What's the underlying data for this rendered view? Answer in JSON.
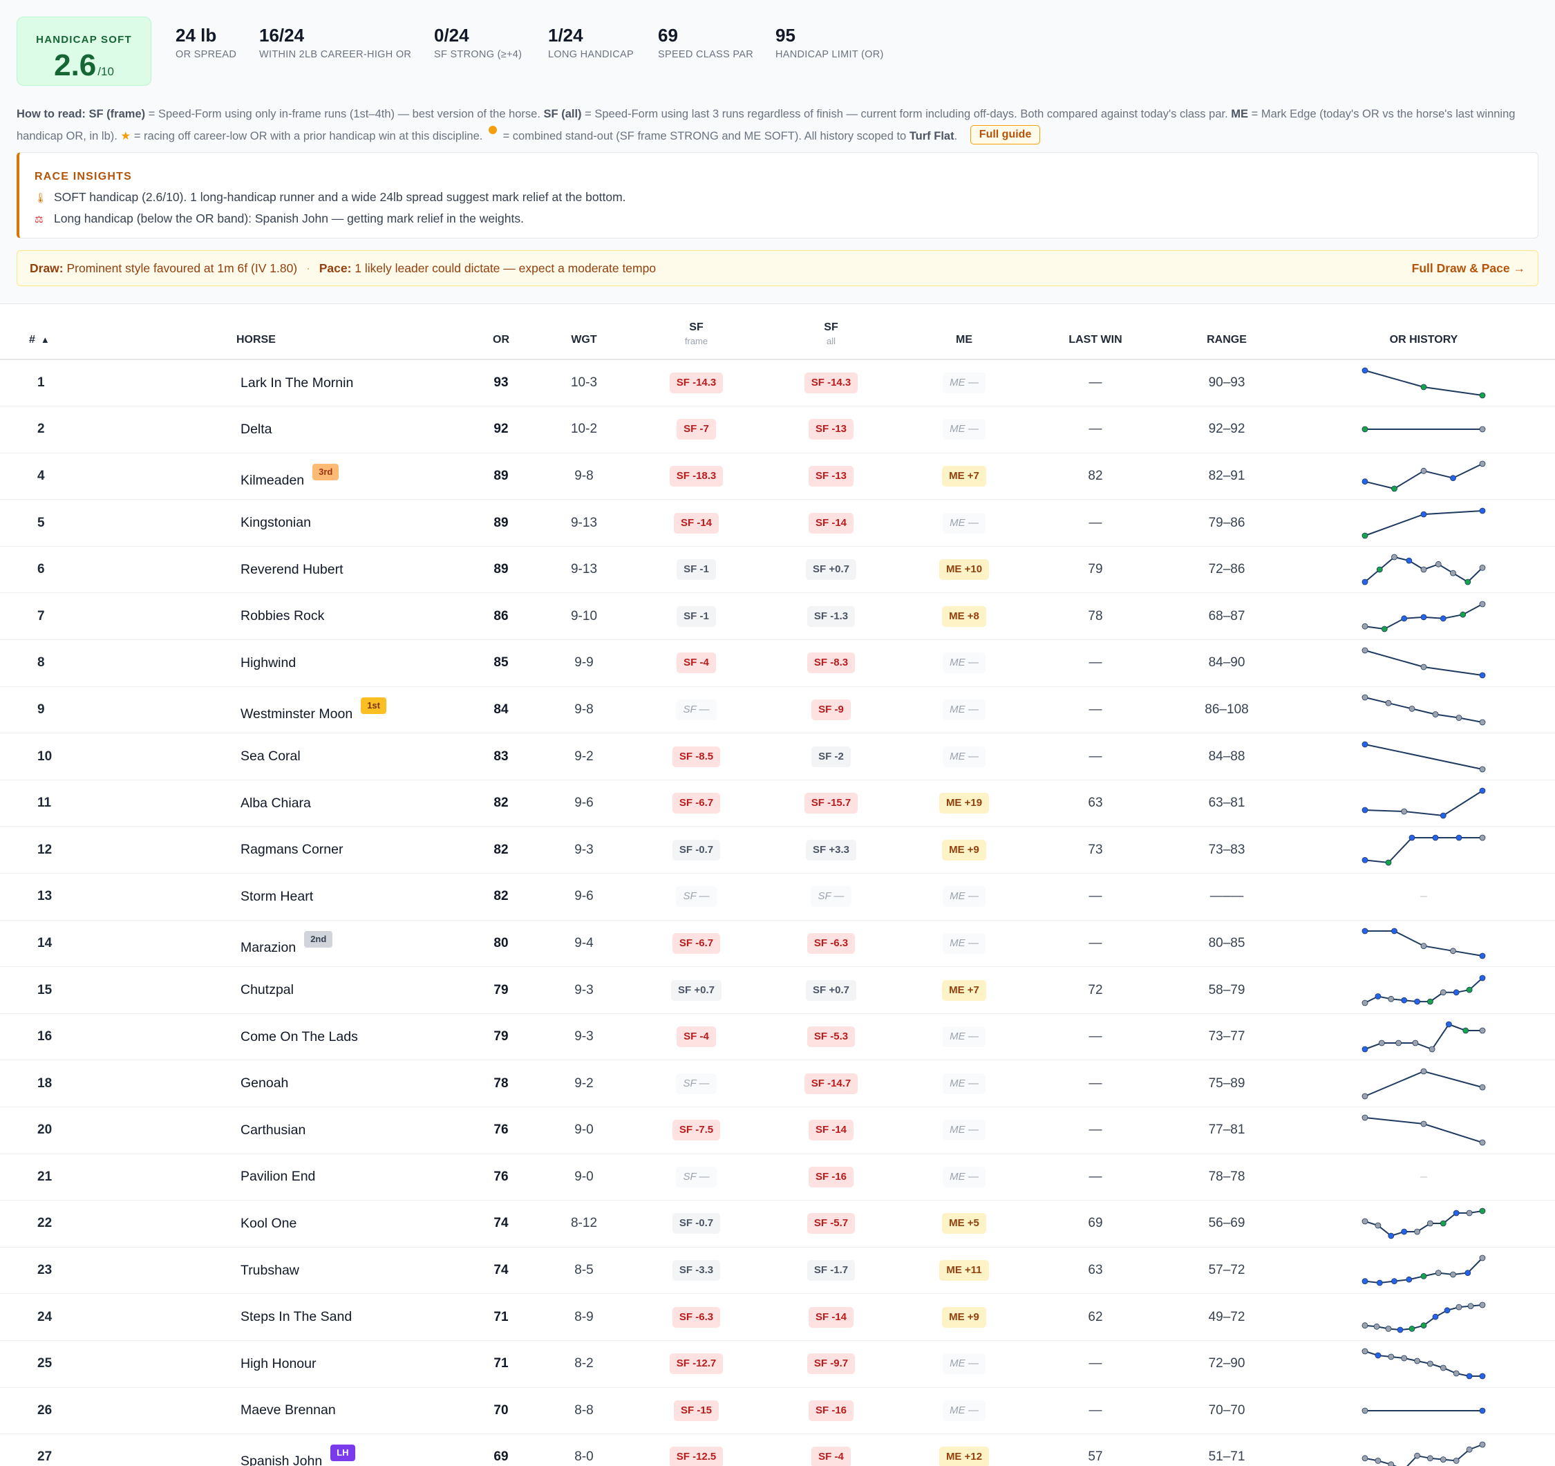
{
  "stats": {
    "handicap_label": "HANDICAP SOFT",
    "handicap_score": "2.6",
    "handicap_suffix": "/10",
    "items": [
      {
        "value": "24 lb",
        "label": "OR SPREAD"
      },
      {
        "value": "16/24",
        "label": "WITHIN 2LB CAREER-HIGH OR"
      },
      {
        "value": "0/24",
        "label": "SF STRONG (≥+4)"
      },
      {
        "value": "1/24",
        "label": "LONG HANDICAP"
      },
      {
        "value": "69",
        "label": "SPEED CLASS PAR"
      },
      {
        "value": "95",
        "label": "HANDICAP LIMIT (OR)"
      }
    ]
  },
  "howto": {
    "lead": "How to read:",
    "sf_frame": "SF (frame)",
    "t1": "= Speed-Form using only in-frame runs (1st–4th) — best version of the horse.",
    "sf_all": "SF (all)",
    "t2": "= Speed-Form using last 3 runs regardless of finish — current form including off-days. Both compared against today's class par.",
    "me": "ME",
    "t3": "= Mark Edge (today's OR vs the horse's last winning handicap OR, in lb).",
    "star": "★",
    "t4": "= racing off career-low OR with a prior handicap win at this discipline.",
    "t5": "= combined stand-out (SF frame STRONG and ME SOFT). All history scoped to",
    "scope": "Turf Flat",
    "t6": ".",
    "guide_button": "Full guide"
  },
  "insights": {
    "title": "RACE INSIGHTS",
    "items": [
      {
        "icon": "🌡",
        "text": "SOFT handicap (2.6/10). 1 long-handicap runner and a wide 24lb spread suggest mark relief at the bottom."
      },
      {
        "icon": "⚖",
        "text": "Long handicap (below the OR band): Spanish John — getting mark relief in the weights."
      }
    ]
  },
  "drawpace": {
    "draw_label": "Draw:",
    "draw_text": "Prominent style favoured at 1m 6f (IV 1.80)",
    "sep": "·",
    "pace_label": "Pace:",
    "pace_text": "1 likely leader could dictate — expect a moderate tempo",
    "link": "Full Draw & Pace →"
  },
  "colors": {
    "accent": "#d97706",
    "soft": "#166534",
    "spark_blue": "#2563eb",
    "spark_green": "#16a34a",
    "spark_grey": "#9ca3af",
    "spark_line": "#1e3a5f"
  },
  "table": {
    "headers": {
      "num": "#",
      "sort": "▲",
      "horse": "HORSE",
      "or": "OR",
      "wgt": "WGT",
      "sf_frame": "SF",
      "sf_frame_sub": "frame",
      "sf_all": "SF",
      "sf_all_sub": "all",
      "me": "ME",
      "last_win": "LAST WIN",
      "range": "RANGE",
      "history": "OR HISTORY"
    },
    "rows": [
      {
        "num": "1",
        "horse": "Lark In The Mornin",
        "badge": "",
        "or": "93",
        "wgt": "10-3",
        "sf_frame": "SF -14.3",
        "sf_frame_tone": "red",
        "sf_all": "SF -14.3",
        "sf_all_tone": "red",
        "me": "ME —",
        "me_tone": "empty",
        "last_win": "—",
        "range": "90–93",
        "history": [
          93,
          91,
          90
        ],
        "marks": [
          "b",
          "g",
          "g"
        ]
      },
      {
        "num": "2",
        "horse": "Delta",
        "badge": "",
        "or": "92",
        "wgt": "10-2",
        "sf_frame": "SF -7",
        "sf_frame_tone": "red",
        "sf_all": "SF -13",
        "sf_all_tone": "red",
        "me": "ME —",
        "me_tone": "empty",
        "last_win": "—",
        "range": "92–92",
        "history": [
          92,
          92
        ],
        "marks": [
          "g",
          "x"
        ]
      },
      {
        "num": "4",
        "horse": "Kilmeaden",
        "badge": "3rd",
        "badge_tone": "3rd",
        "or": "89",
        "wgt": "9-8",
        "sf_frame": "SF -18.3",
        "sf_frame_tone": "red",
        "sf_all": "SF -13",
        "sf_all_tone": "red",
        "me": "ME +7",
        "me_tone": "me",
        "last_win": "82",
        "range": "82–91",
        "history": [
          84,
          82,
          87,
          85,
          89
        ],
        "marks": [
          "b",
          "g",
          "x",
          "b",
          "x"
        ]
      },
      {
        "num": "5",
        "horse": "Kingstonian",
        "badge": "",
        "or": "89",
        "wgt": "9-13",
        "sf_frame": "SF -14",
        "sf_frame_tone": "red",
        "sf_all": "SF -14",
        "sf_all_tone": "red",
        "me": "ME —",
        "me_tone": "empty",
        "last_win": "—",
        "range": "79–86",
        "history": [
          79,
          85,
          86
        ],
        "marks": [
          "g",
          "b",
          "b"
        ]
      },
      {
        "num": "6",
        "horse": "Reverend Hubert",
        "badge": "",
        "or": "89",
        "wgt": "9-13",
        "sf_frame": "SF -1",
        "sf_frame_tone": "grey",
        "sf_all": "SF +0.7",
        "sf_all_tone": "grey",
        "me": "ME +10",
        "me_tone": "me",
        "last_win": "79",
        "range": "72–86",
        "history": [
          72,
          79,
          86,
          84,
          79,
          82,
          77,
          72,
          80
        ],
        "marks": [
          "b",
          "g",
          "x",
          "b",
          "x",
          "x",
          "x",
          "g",
          "x"
        ]
      },
      {
        "num": "7",
        "horse": "Robbies Rock",
        "badge": "",
        "or": "86",
        "wgt": "9-10",
        "sf_frame": "SF -1",
        "sf_frame_tone": "grey",
        "sf_all": "SF -1.3",
        "sf_all_tone": "grey",
        "me": "ME +8",
        "me_tone": "me",
        "last_win": "78",
        "range": "68–87",
        "history": [
          70,
          68,
          76,
          77,
          76,
          79,
          87
        ],
        "marks": [
          "x",
          "g",
          "b",
          "b",
          "b",
          "g",
          "x"
        ]
      },
      {
        "num": "8",
        "horse": "Highwind",
        "badge": "",
        "or": "85",
        "wgt": "9-9",
        "sf_frame": "SF -4",
        "sf_frame_tone": "red",
        "sf_all": "SF -8.3",
        "sf_all_tone": "red",
        "me": "ME —",
        "me_tone": "empty",
        "last_win": "—",
        "range": "84–90",
        "history": [
          90,
          86,
          84
        ],
        "marks": [
          "x",
          "x",
          "b"
        ]
      },
      {
        "num": "9",
        "horse": "Westminster Moon",
        "badge": "1st",
        "badge_tone": "1st",
        "or": "84",
        "wgt": "9-8",
        "sf_frame": "SF —",
        "sf_frame_tone": "empty",
        "sf_all": "SF -9",
        "sf_all_tone": "red",
        "me": "ME —",
        "me_tone": "empty",
        "last_win": "—",
        "range": "86–108",
        "history": [
          108,
          103,
          98,
          93,
          90,
          86
        ],
        "marks": [
          "x",
          "x",
          "x",
          "x",
          "x",
          "x"
        ]
      },
      {
        "num": "10",
        "horse": "Sea Coral",
        "badge": "",
        "or": "83",
        "wgt": "9-2",
        "sf_frame": "SF -8.5",
        "sf_frame_tone": "red",
        "sf_all": "SF -2",
        "sf_all_tone": "grey",
        "me": "ME —",
        "me_tone": "empty",
        "last_win": "—",
        "range": "84–88",
        "history": [
          88,
          84
        ],
        "marks": [
          "b",
          "x"
        ]
      },
      {
        "num": "11",
        "horse": "Alba Chiara",
        "badge": "",
        "or": "82",
        "wgt": "9-6",
        "sf_frame": "SF -6.7",
        "sf_frame_tone": "red",
        "sf_all": "SF -15.7",
        "sf_all_tone": "red",
        "me": "ME +19",
        "me_tone": "me",
        "last_win": "63",
        "range": "63–81",
        "history": [
          67,
          66,
          63,
          81
        ],
        "marks": [
          "b",
          "x",
          "b",
          "b"
        ]
      },
      {
        "num": "12",
        "horse": "Ragmans Corner",
        "badge": "",
        "or": "82",
        "wgt": "9-3",
        "sf_frame": "SF -0.7",
        "sf_frame_tone": "grey",
        "sf_all": "SF +3.3",
        "sf_all_tone": "grey",
        "me": "ME +9",
        "me_tone": "me",
        "last_win": "73",
        "range": "73–83",
        "history": [
          74,
          73,
          83,
          83,
          83,
          83
        ],
        "marks": [
          "b",
          "g",
          "b",
          "b",
          "b",
          "x"
        ]
      },
      {
        "num": "13",
        "horse": "Storm Heart",
        "badge": "",
        "or": "82",
        "wgt": "9-6",
        "sf_frame": "SF —",
        "sf_frame_tone": "empty",
        "sf_all": "SF —",
        "sf_all_tone": "empty",
        "me": "ME —",
        "me_tone": "empty",
        "last_win": "—",
        "range": "—–—",
        "history": [],
        "marks": []
      },
      {
        "num": "14",
        "horse": "Marazion",
        "badge": "2nd",
        "badge_tone": "2nd",
        "or": "80",
        "wgt": "9-4",
        "sf_frame": "SF -6.7",
        "sf_frame_tone": "red",
        "sf_all": "SF -6.3",
        "sf_all_tone": "red",
        "me": "ME —",
        "me_tone": "empty",
        "last_win": "—",
        "range": "80–85",
        "history": [
          85,
          85,
          82,
          81,
          80
        ],
        "marks": [
          "b",
          "b",
          "x",
          "x",
          "b"
        ]
      },
      {
        "num": "15",
        "horse": "Chutzpal",
        "badge": "",
        "or": "79",
        "wgt": "9-3",
        "sf_frame": "SF +0.7",
        "sf_frame_tone": "grey",
        "sf_all": "SF +0.7",
        "sf_all_tone": "grey",
        "me": "ME +7",
        "me_tone": "me",
        "last_win": "72",
        "range": "58–79",
        "history": [
          60,
          65,
          63,
          62,
          61,
          61,
          68,
          68,
          70,
          79
        ],
        "marks": [
          "x",
          "b",
          "x",
          "b",
          "b",
          "g",
          "x",
          "b",
          "g",
          "b"
        ]
      },
      {
        "num": "16",
        "horse": "Come On The Lads",
        "badge": "",
        "or": "79",
        "wgt": "9-3",
        "sf_frame": "SF -4",
        "sf_frame_tone": "red",
        "sf_all": "SF -5.3",
        "sf_all_tone": "red",
        "me": "ME —",
        "me_tone": "empty",
        "last_win": "—",
        "range": "73–77",
        "history": [
          73,
          74,
          74,
          74,
          73,
          77,
          76,
          76
        ],
        "marks": [
          "b",
          "x",
          "x",
          "x",
          "x",
          "b",
          "g",
          "x"
        ]
      },
      {
        "num": "18",
        "horse": "Genoah",
        "badge": "",
        "or": "78",
        "wgt": "9-2",
        "sf_frame": "SF —",
        "sf_frame_tone": "empty",
        "sf_all": "SF -14.7",
        "sf_all_tone": "red",
        "me": "ME —",
        "me_tone": "empty",
        "last_win": "—",
        "range": "75–89",
        "history": [
          75,
          89,
          80
        ],
        "marks": [
          "x",
          "x",
          "x"
        ]
      },
      {
        "num": "20",
        "horse": "Carthusian",
        "badge": "",
        "or": "76",
        "wgt": "9-0",
        "sf_frame": "SF -7.5",
        "sf_frame_tone": "red",
        "sf_all": "SF -14",
        "sf_all_tone": "red",
        "me": "ME —",
        "me_tone": "empty",
        "last_win": "—",
        "range": "77–81",
        "history": [
          81,
          80,
          77
        ],
        "marks": [
          "x",
          "x",
          "x"
        ]
      },
      {
        "num": "21",
        "horse": "Pavilion End",
        "badge": "",
        "or": "76",
        "wgt": "9-0",
        "sf_frame": "SF —",
        "sf_frame_tone": "empty",
        "sf_all": "SF -16",
        "sf_all_tone": "red",
        "me": "ME —",
        "me_tone": "empty",
        "last_win": "—",
        "range": "78–78",
        "history": [],
        "marks": []
      },
      {
        "num": "22",
        "horse": "Kool One",
        "badge": "",
        "or": "74",
        "wgt": "8-12",
        "sf_frame": "SF -0.7",
        "sf_frame_tone": "grey",
        "sf_all": "SF -5.7",
        "sf_all_tone": "red",
        "me": "ME +5",
        "me_tone": "me",
        "last_win": "69",
        "range": "56–69",
        "history": [
          64,
          62,
          57,
          59,
          59,
          63,
          63,
          68,
          68,
          69
        ],
        "marks": [
          "x",
          "x",
          "b",
          "b",
          "x",
          "x",
          "g",
          "b",
          "x",
          "g"
        ]
      },
      {
        "num": "23",
        "horse": "Trubshaw",
        "badge": "",
        "or": "74",
        "wgt": "8-5",
        "sf_frame": "SF -3.3",
        "sf_frame_tone": "grey",
        "sf_all": "SF -1.7",
        "sf_all_tone": "grey",
        "me": "ME +11",
        "me_tone": "me",
        "last_win": "63",
        "range": "57–72",
        "history": [
          58,
          57,
          58,
          59,
          61,
          63,
          62,
          63,
          72
        ],
        "marks": [
          "b",
          "b",
          "b",
          "b",
          "g",
          "x",
          "x",
          "b",
          "x"
        ]
      },
      {
        "num": "24",
        "horse": "Steps In The Sand",
        "badge": "",
        "or": "71",
        "wgt": "8-9",
        "sf_frame": "SF -6.3",
        "sf_frame_tone": "red",
        "sf_all": "SF -14",
        "sf_all_tone": "red",
        "me": "ME +9",
        "me_tone": "me",
        "last_win": "62",
        "range": "49–72",
        "history": [
          53,
          52,
          50,
          49,
          50,
          53,
          61,
          67,
          70,
          71,
          72
        ],
        "marks": [
          "x",
          "x",
          "x",
          "b",
          "g",
          "g",
          "b",
          "b",
          "x",
          "x",
          "x"
        ]
      },
      {
        "num": "25",
        "horse": "High Honour",
        "badge": "",
        "or": "71",
        "wgt": "8-2",
        "sf_frame": "SF -12.7",
        "sf_frame_tone": "red",
        "sf_all": "SF -9.7",
        "sf_all_tone": "red",
        "me": "ME —",
        "me_tone": "empty",
        "last_win": "—",
        "range": "72–90",
        "history": [
          90,
          87,
          86,
          85,
          83,
          81,
          78,
          74,
          72,
          72
        ],
        "marks": [
          "x",
          "b",
          "x",
          "x",
          "x",
          "x",
          "x",
          "x",
          "b",
          "b"
        ]
      },
      {
        "num": "26",
        "horse": "Maeve Brennan",
        "badge": "",
        "or": "70",
        "wgt": "8-8",
        "sf_frame": "SF -15",
        "sf_frame_tone": "red",
        "sf_all": "SF -16",
        "sf_all_tone": "red",
        "me": "ME —",
        "me_tone": "empty",
        "last_win": "—",
        "range": "70–70",
        "history": [
          70,
          70
        ],
        "marks": [
          "x",
          "b"
        ]
      },
      {
        "num": "27",
        "horse": "Spanish John",
        "badge": "LH",
        "badge_tone": "lh",
        "or": "69",
        "wgt": "8-0",
        "sf_frame": "SF -12.5",
        "sf_frame_tone": "red",
        "sf_all": "SF -4",
        "sf_all_tone": "red",
        "me": "ME +12",
        "me_tone": "me",
        "last_win": "57",
        "range": "51–71",
        "history": [
          60,
          58,
          55,
          51,
          62,
          60,
          59,
          58,
          67,
          71
        ],
        "marks": [
          "x",
          "x",
          "x",
          "g",
          "x",
          "x",
          "x",
          "x",
          "x",
          "x"
        ]
      }
    ]
  }
}
